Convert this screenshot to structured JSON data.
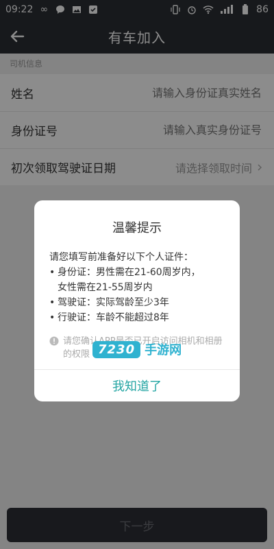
{
  "status_bar": {
    "time": "09:22",
    "battery": "86",
    "signal_text": "4G"
  },
  "app_bar": {
    "title": "有车加入"
  },
  "form": {
    "section_title": "司机信息",
    "fields": [
      {
        "label": "姓名",
        "placeholder": "请输入身份证真实姓名"
      },
      {
        "label": "身份证号",
        "placeholder": "请输入真实身份证号"
      },
      {
        "label": "初次领取驾驶证日期",
        "placeholder": "请选择领取时间"
      }
    ]
  },
  "footer": {
    "next_label": "下一步"
  },
  "dialog": {
    "title": "温馨提示",
    "intro": "请您填写前准备好以下个人证件：",
    "items": [
      {
        "text": "身份证：男性需在21-60周岁内，"
      },
      {
        "text": "女性需在21-55周岁内"
      },
      {
        "text": "驾驶证：实际驾龄至少3年"
      },
      {
        "text": "行驶证：车龄不能超过8年"
      }
    ],
    "note": "请您确认APP是否已开启访问相机和相册的权限",
    "ok_label": "我知道了"
  },
  "watermark": {
    "logo": "7230",
    "text": "手游网"
  },
  "colors": {
    "appbar": "#2b2e34",
    "accent": "#24a5a3",
    "button_bg": "#2d2f35"
  }
}
